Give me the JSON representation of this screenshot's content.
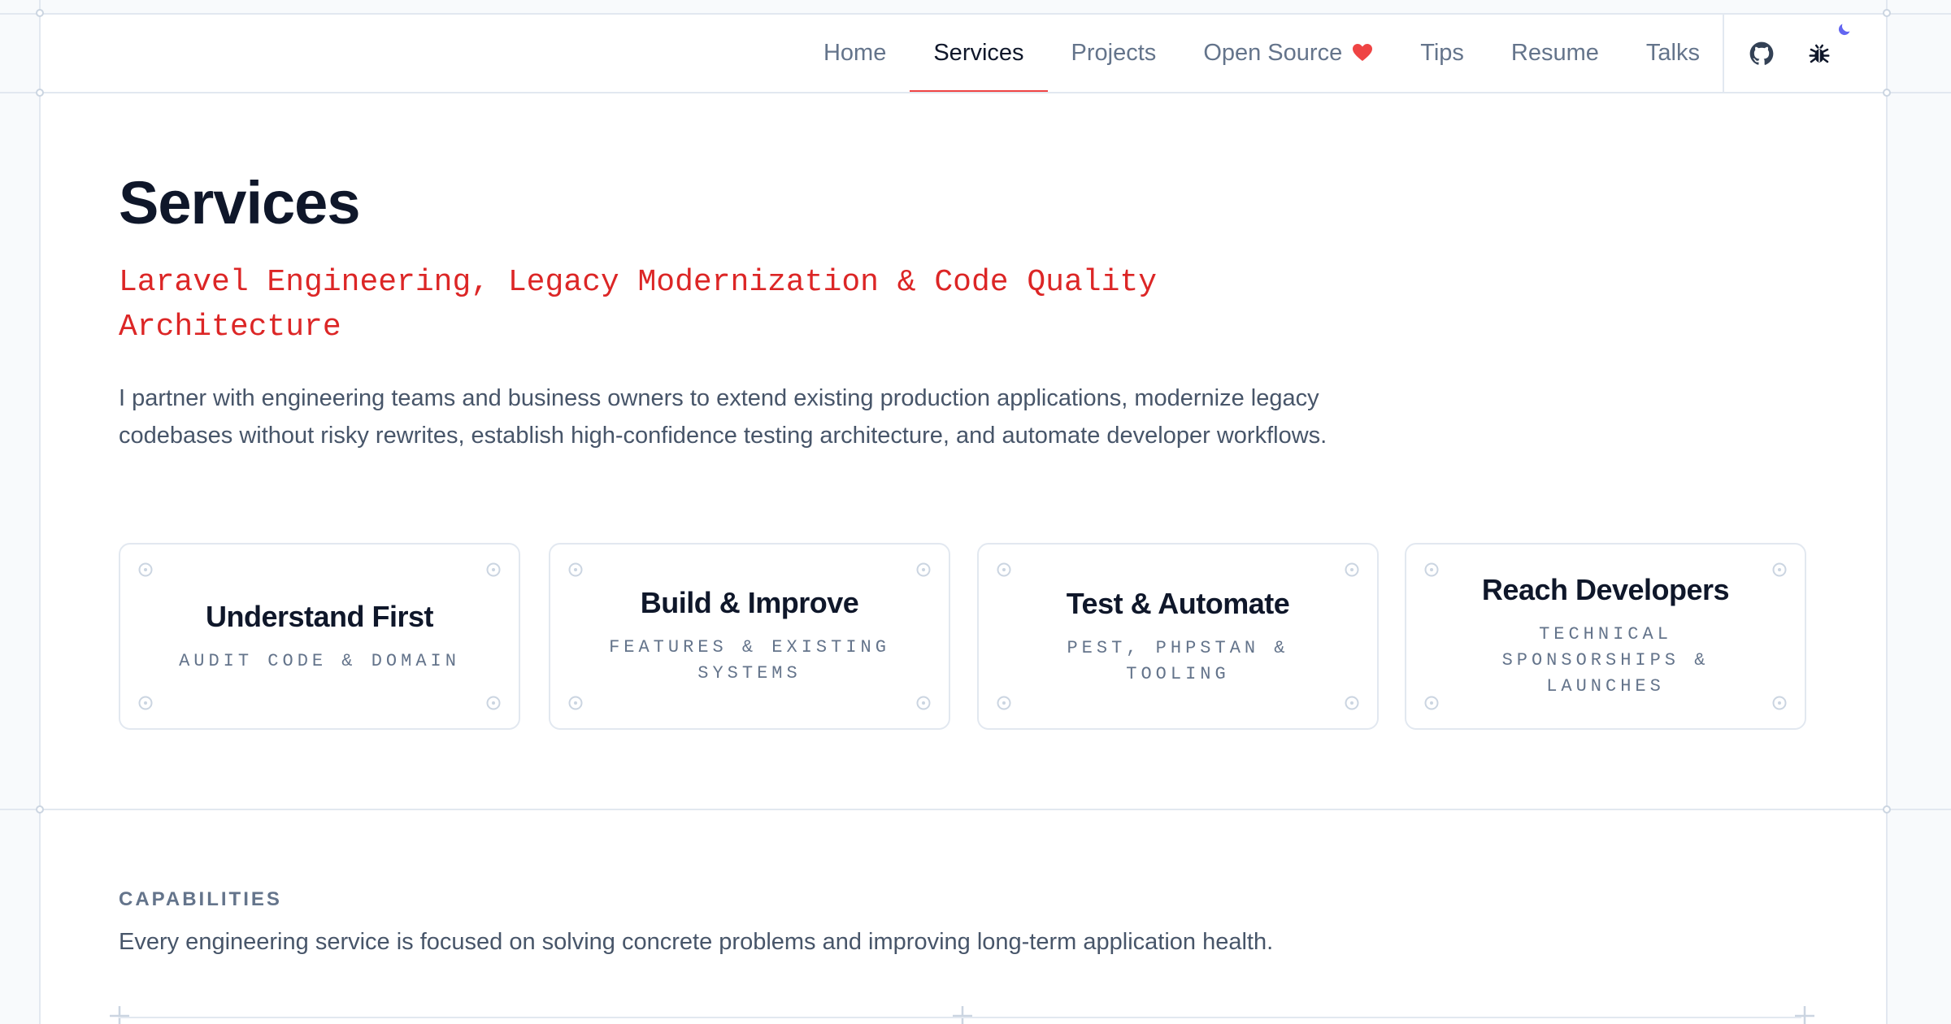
{
  "nav": {
    "items": [
      {
        "label": "Home",
        "active": false
      },
      {
        "label": "Services",
        "active": true
      },
      {
        "label": "Projects",
        "active": false
      },
      {
        "label": "Open Source",
        "active": false
      },
      {
        "label": "Tips",
        "active": false
      },
      {
        "label": "Resume",
        "active": false
      },
      {
        "label": "Talks",
        "active": false
      }
    ],
    "icons": [
      "github-icon",
      "bug-icon",
      "moon-icon"
    ],
    "accent_color": "#ef4444"
  },
  "hero": {
    "title": "Services",
    "subtitle": "Laravel Engineering, Legacy Modernization & Code Quality Architecture",
    "intro": "I partner with engineering teams and business owners to extend existing production applications, modernize legacy codebases without risky rewrites, establish high-confidence testing architecture, and automate developer workflows.",
    "cards": [
      {
        "title": "Understand First",
        "subtitle": "AUDIT CODE & DOMAIN"
      },
      {
        "title": "Build & Improve",
        "subtitle": "FEATURES & EXISTING SYSTEMS"
      },
      {
        "title": "Test & Automate",
        "subtitle": "PEST, PHPSTAN & TOOLING"
      },
      {
        "title": "Reach Developers",
        "subtitle": "TECHNICAL SPONSORSHIPS & LAUNCHES"
      }
    ]
  },
  "capabilities": {
    "label": "CAPABILITIES",
    "text": "Every engineering service is focused on solving concrete problems and improving long-term application health."
  },
  "colors": {
    "title": "#0f172a",
    "subtitle": "#dc2626",
    "muted": "#64748b",
    "border": "#e2e8f0",
    "moon": "#6366f1"
  }
}
